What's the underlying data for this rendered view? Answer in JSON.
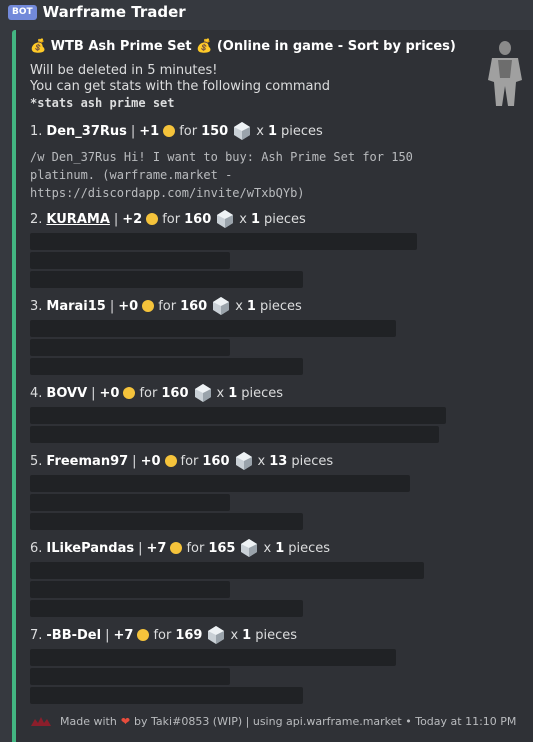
{
  "bot": {
    "tag": "BOT",
    "name": "Warframe Trader"
  },
  "embed": {
    "title": "💰 WTB Ash Prime Set 💰  (Online in game - Sort by prices)",
    "description_lines": [
      "Will be deleted in 5 minutes!",
      "You can get stats with the following command"
    ],
    "command": "*stats ash prime set",
    "whisper_lines": [
      "/w Den_37Rus Hi! I want to buy: Ash Prime Set for 150",
      "platinum. (warframe.market -",
      "https://discordapp.com/invite/wTxbQYb)"
    ],
    "entries": [
      {
        "rank": "1.",
        "name": "Den_37Rus",
        "sep": "|",
        "rep": "+1",
        "for": "for",
        "price": "150",
        "x": "x",
        "qty": "1",
        "unit": "pieces"
      },
      {
        "rank": "2.",
        "name": "KURAMA",
        "sep": "|",
        "rep": "+2",
        "for": "for",
        "price": "160",
        "x": "x",
        "qty": "1",
        "unit": "pieces"
      },
      {
        "rank": "3.",
        "name": "Marai15",
        "sep": "|",
        "rep": "+0",
        "for": "for",
        "price": "160",
        "x": "x",
        "qty": "1",
        "unit": "pieces"
      },
      {
        "rank": "4.",
        "name": "BOVV",
        "sep": "|",
        "rep": "+0",
        "for": "for",
        "price": "160",
        "x": "x",
        "qty": "1",
        "unit": "pieces"
      },
      {
        "rank": "5.",
        "name": "Freeman97",
        "sep": "|",
        "rep": "+0",
        "for": "for",
        "price": "160",
        "x": "x",
        "qty": "13",
        "unit": "pieces"
      },
      {
        "rank": "6.",
        "name": "ILikePandas",
        "sep": "|",
        "rep": "+7",
        "for": "for",
        "price": "165",
        "x": "x",
        "qty": "1",
        "unit": "pieces"
      },
      {
        "rank": "7.",
        "name": "-BB-Del",
        "sep": "|",
        "rep": "+7",
        "for": "for",
        "price": "169",
        "x": "x",
        "qty": "1",
        "unit": "pieces"
      }
    ],
    "footer": {
      "made_with": "Made with",
      "heart": "❤",
      "by_text": "by Taki#0853 (WIP) | using api.warframe.market • Today at 11:10 PM"
    }
  },
  "colors": {
    "accent": "#43b581",
    "background": "#36393f",
    "embed_bg": "#2f3136",
    "spoiler": "#202225"
  },
  "icons": {
    "smile": "slightly-smiling-face-icon",
    "platinum": "platinum-icon",
    "warframe": "warframe-thumbnail",
    "heart": "heart-icon"
  }
}
